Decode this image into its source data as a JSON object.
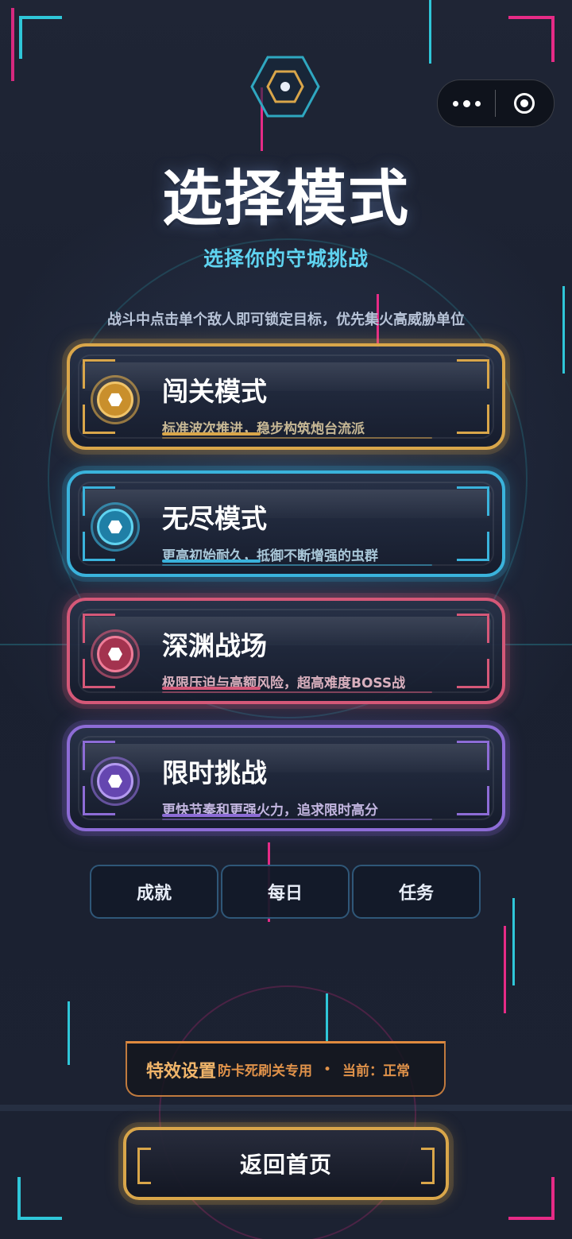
{
  "title": "选择模式",
  "subtitle": "选择你的守城挑战",
  "hint": "战斗中点击单个敌人即可锁定目标，优先集火高威胁单位",
  "modes": [
    {
      "name": "闯关模式",
      "desc": "标准波次推进，稳步构筑炮台流派",
      "color": "#d9a64a",
      "desc_color": "#c7b895"
    },
    {
      "name": "无尽模式",
      "desc": "更高初始耐久，抵御不断增强的虫群",
      "color": "#3ab3dc",
      "desc_color": "#a9c7d8"
    },
    {
      "name": "深渊战场",
      "desc": "极限压迫与高额风险，超高难度BOSS战",
      "color": "#d55878",
      "desc_color": "#d9b0be"
    },
    {
      "name": "限时挑战",
      "desc": "更快节奏和更强火力，追求限时高分",
      "color": "#8d6cd6",
      "desc_color": "#c3b6e0"
    }
  ],
  "tabs": [
    "成就",
    "每日",
    "任务"
  ],
  "effects": {
    "title": "特效设置",
    "desc": "防卡死刷关专用",
    "separator": "•",
    "current": "当前：正常"
  },
  "home_button": "返回首页",
  "capsule": {
    "more_icon": "more-dots-icon",
    "close_icon": "target-close-icon"
  }
}
